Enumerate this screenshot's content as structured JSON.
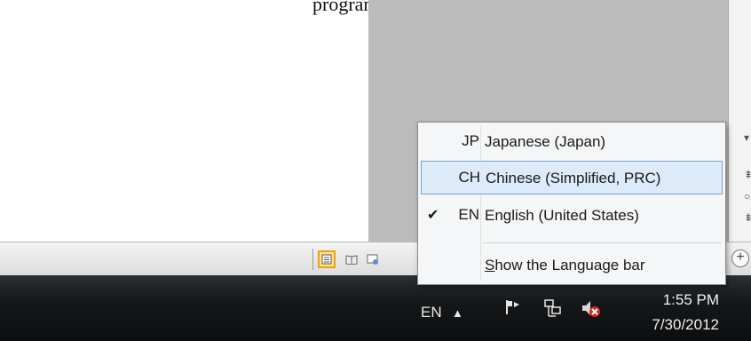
{
  "document": {
    "visible_text": "program, one that works well (except"
  },
  "status_bar": {
    "view_buttons": [
      "print-layout",
      "full-screen-reading",
      "web-layout"
    ],
    "zoom_in_label": "+"
  },
  "language_menu": {
    "items": [
      {
        "code": "JP",
        "name": "Japanese (Japan)",
        "checked": false,
        "hovered": false
      },
      {
        "code": "CH",
        "name": "Chinese (Simplified, PRC)",
        "checked": false,
        "hovered": true
      },
      {
        "code": "EN",
        "name": "English (United States)",
        "checked": true,
        "hovered": false
      }
    ],
    "check_mark": "✔",
    "show_bar": {
      "prefix": "S",
      "rest": "how the Language bar"
    }
  },
  "taskbar": {
    "language": "EN",
    "overflow_arrow": "▲",
    "clock": {
      "time": "1:55 PM",
      "date": "7/30/2012"
    },
    "icons": [
      "flag-icon",
      "network-icon",
      "volume-muted-icon"
    ]
  },
  "colors": {
    "menu_hover": "#dceaf9",
    "menu_hover_border": "#7da2ce",
    "taskbar": "#151719",
    "active_view": "#ffe48a"
  }
}
